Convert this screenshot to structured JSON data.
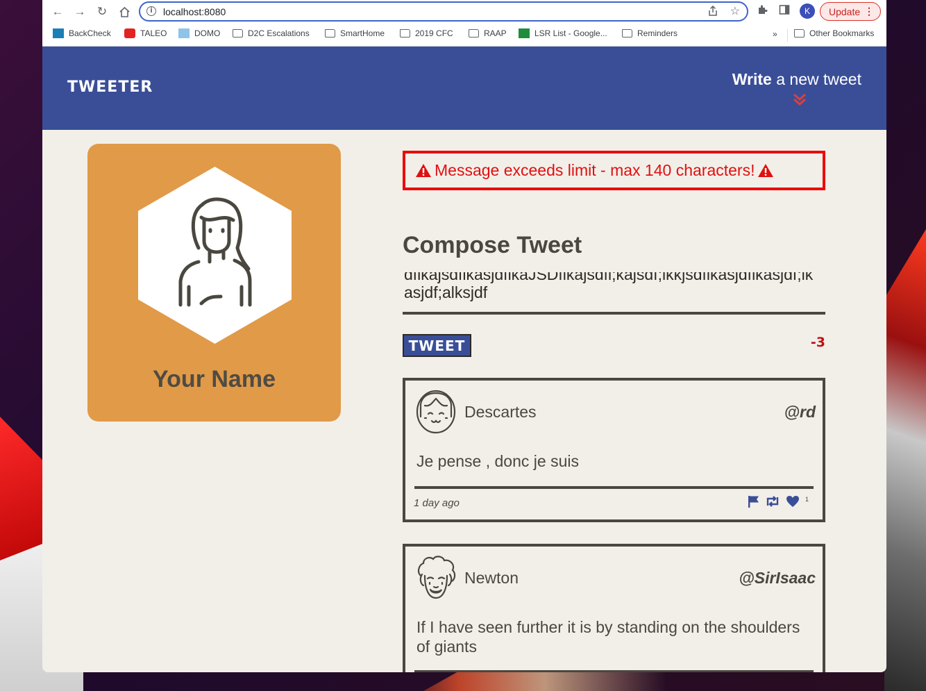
{
  "browser": {
    "url": "localhost:8080",
    "avatar_letter": "K",
    "update_label": "Update",
    "bookmarks": [
      {
        "label": "BackCheck",
        "icon": "backcheck-icon"
      },
      {
        "label": "TALEO",
        "icon": "taleo-icon"
      },
      {
        "label": "DOMO",
        "icon": "domo-icon"
      },
      {
        "label": "D2C Escalations",
        "icon": "folder-icon"
      },
      {
        "label": "SmartHome",
        "icon": "folder-icon"
      },
      {
        "label": "2019 CFC",
        "icon": "folder-icon"
      },
      {
        "label": "RAAP",
        "icon": "folder-icon"
      },
      {
        "label": "LSR List - Google...",
        "icon": "sheets-icon"
      },
      {
        "label": "Reminders",
        "icon": "folder-icon"
      }
    ],
    "more_label": "»",
    "other_bookmarks": "Other Bookmarks"
  },
  "header": {
    "brand": "TWEETER",
    "write_bold": "Write",
    "write_rest": " a new tweet"
  },
  "profile": {
    "name": "Your Name"
  },
  "compose": {
    "error": "Message exceeds limit - max 140 characters!",
    "title": "Compose Tweet",
    "text": "dflkajsdflkasjdflkaJSDflkajsdfl;kajsdf;lkkjsdflkasjdflkasjdf;lkasjdf;alksjdf",
    "button": "TWEET",
    "counter": "-3"
  },
  "tweets": [
    {
      "name": "Descartes",
      "handle": "@rd",
      "body": "Je pense , donc je suis",
      "time": "1 day ago",
      "likes": "1"
    },
    {
      "name": "Newton",
      "handle": "@SirIsaac",
      "body": "If I have seen further it is by standing on the shoulders of giants"
    }
  ],
  "colors": {
    "header_bg": "#3a4e98",
    "card_bg": "#e19a47",
    "page_bg": "#f2efe9",
    "error_red": "#ec0a0a",
    "ink": "#4a4740"
  }
}
